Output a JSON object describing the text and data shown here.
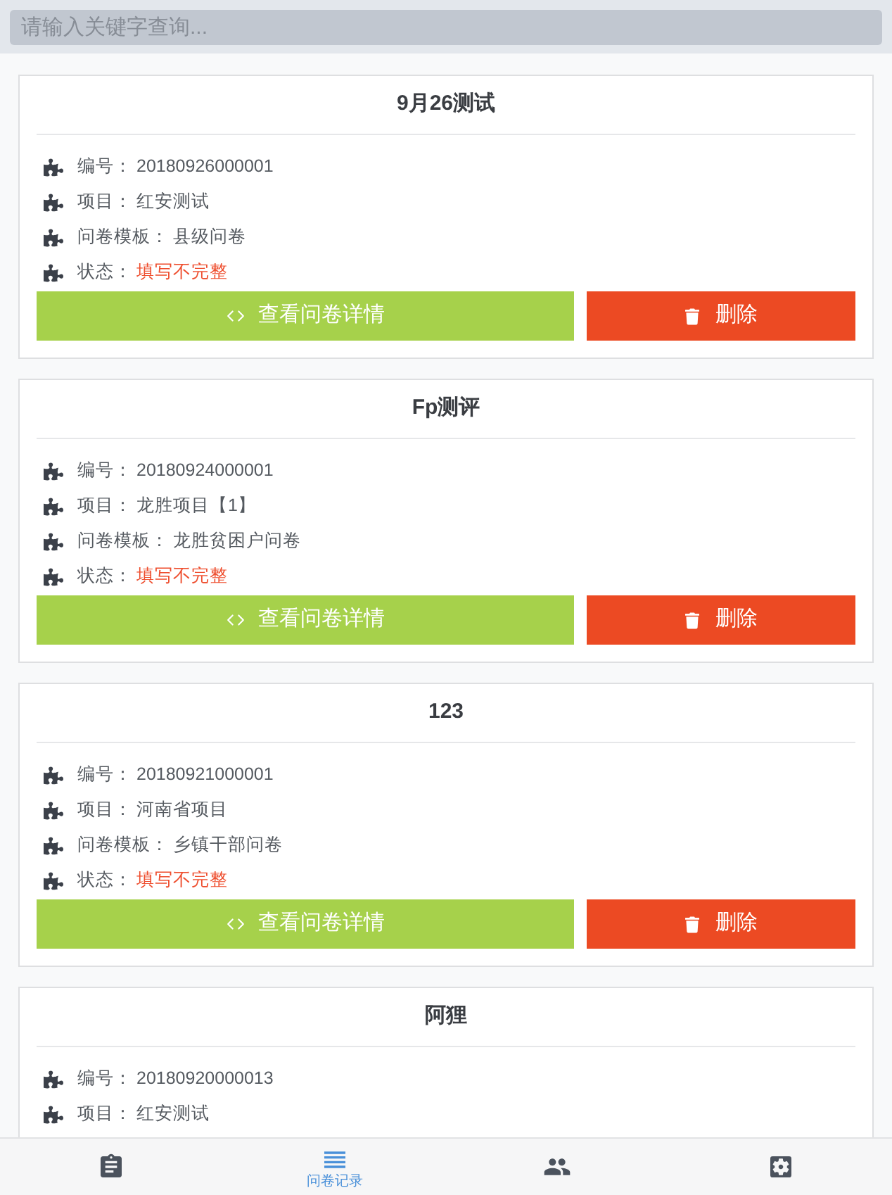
{
  "search": {
    "placeholder": "请输入关键字查询..."
  },
  "cards": [
    {
      "title": "9月26测试",
      "fields": [
        {
          "label": "编号：",
          "value": "20180926000001",
          "kind": "plain"
        },
        {
          "label": "项目：",
          "value": "红安测试",
          "kind": "plain"
        },
        {
          "label": "问卷模板：",
          "value": "县级问卷",
          "kind": "plain"
        },
        {
          "label": "状态：",
          "value": "填写不完整",
          "kind": "status"
        }
      ],
      "view_button": "查看问卷详情",
      "delete_button": "删除"
    },
    {
      "title": "Fp测评",
      "fields": [
        {
          "label": "编号：",
          "value": "20180924000001",
          "kind": "plain"
        },
        {
          "label": "项目：",
          "value": "龙胜项目【1】",
          "kind": "plain"
        },
        {
          "label": "问卷模板：",
          "value": "龙胜贫困户问卷",
          "kind": "plain"
        },
        {
          "label": "状态：",
          "value": "填写不完整",
          "kind": "status"
        }
      ],
      "view_button": "查看问卷详情",
      "delete_button": "删除"
    },
    {
      "title": "123",
      "fields": [
        {
          "label": "编号：",
          "value": "20180921000001",
          "kind": "plain"
        },
        {
          "label": "项目：",
          "value": "河南省项目",
          "kind": "plain"
        },
        {
          "label": "问卷模板：",
          "value": "乡镇干部问卷",
          "kind": "plain"
        },
        {
          "label": "状态：",
          "value": "填写不完整",
          "kind": "status"
        }
      ],
      "view_button": "查看问卷详情",
      "delete_button": "删除"
    },
    {
      "title": "阿狸",
      "fields": [
        {
          "label": "编号：",
          "value": "20180920000013",
          "kind": "plain"
        },
        {
          "label": "项目：",
          "value": "红安测试",
          "kind": "plain"
        }
      ]
    }
  ],
  "tab_bar": [
    {
      "kind": "clipboard",
      "selected": false
    },
    {
      "kind": "list",
      "label": "问卷记录",
      "selected": true
    },
    {
      "kind": "people",
      "selected": false
    },
    {
      "kind": "gear",
      "selected": false
    }
  ]
}
